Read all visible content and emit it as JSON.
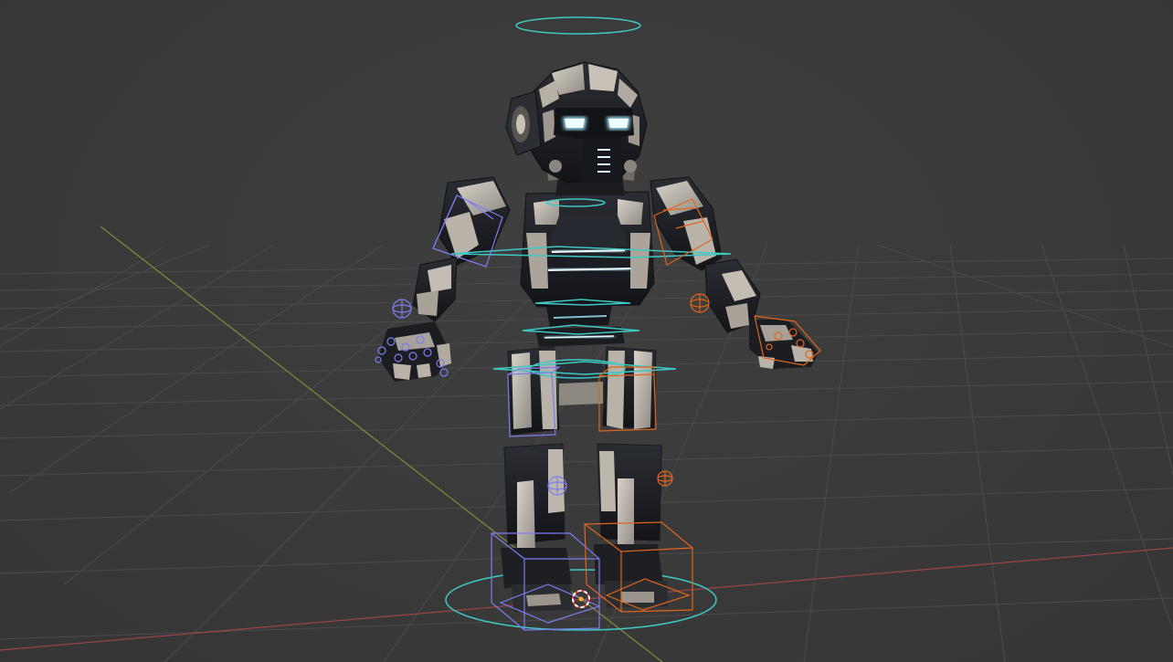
{
  "viewport": {
    "scene": "3d-viewport",
    "object": "robot-character-rig",
    "colors": {
      "background": "#3a3a3a",
      "grid": "#4a4a4a",
      "x_axis": "#b04848",
      "y_axis": "#8a9a3a",
      "bone_ring": "#3fc9c4",
      "left_ik": "#7d7df0",
      "right_ik": "#e0661e",
      "emission": "#9fe8ff",
      "armor_light": "#c9c3ba",
      "armor_dark": "#1c1e22"
    }
  }
}
